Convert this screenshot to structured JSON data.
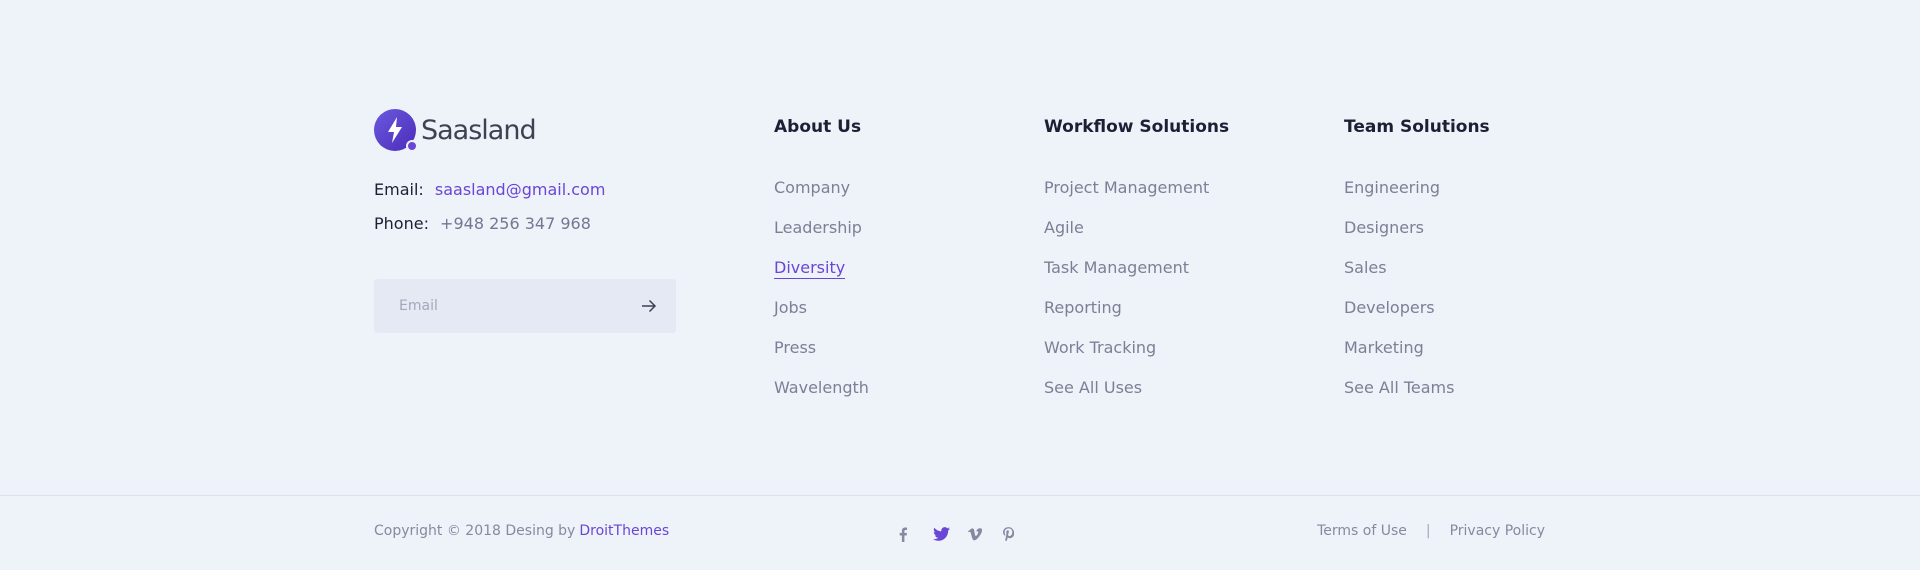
{
  "brand": {
    "name": "Saasland",
    "logo_icon": "lightning-bolt-icon",
    "accent": "#6a46d6"
  },
  "contact": {
    "email_label": "Email:",
    "email_value": "saasland@gmail.com",
    "phone_label": "Phone:",
    "phone_value": "+948 256 347 968"
  },
  "subscribe": {
    "placeholder": "Email",
    "submit_icon": "arrow-right-icon"
  },
  "columns": [
    {
      "title": "About Us",
      "items": [
        "Company",
        "Leadership",
        "Diversity",
        "Jobs",
        "Press",
        "Wavelength"
      ],
      "active_item": "Diversity"
    },
    {
      "title": "Workflow Solutions",
      "items": [
        "Project Management",
        "Agile",
        "Task Management",
        "Reporting",
        "Work Tracking",
        "See All Uses"
      ]
    },
    {
      "title": "Team Solutions",
      "items": [
        "Engineering",
        "Designers",
        "Sales",
        "Developers",
        "Marketing",
        "See All Teams"
      ]
    }
  ],
  "bottom": {
    "copyright_text": "Copyright © 2018 Desing by",
    "copyright_link": "DroitThemes",
    "social": [
      {
        "icon": "facebook-icon",
        "color": "#858aa0"
      },
      {
        "icon": "twitter-icon",
        "color": "#6a46d6"
      },
      {
        "icon": "vimeo-icon",
        "color": "#858aa0"
      },
      {
        "icon": "pinterest-icon",
        "color": "#858aa0"
      }
    ],
    "terms": "Terms of Use",
    "separator": "|",
    "privacy": "Privacy Policy"
  }
}
